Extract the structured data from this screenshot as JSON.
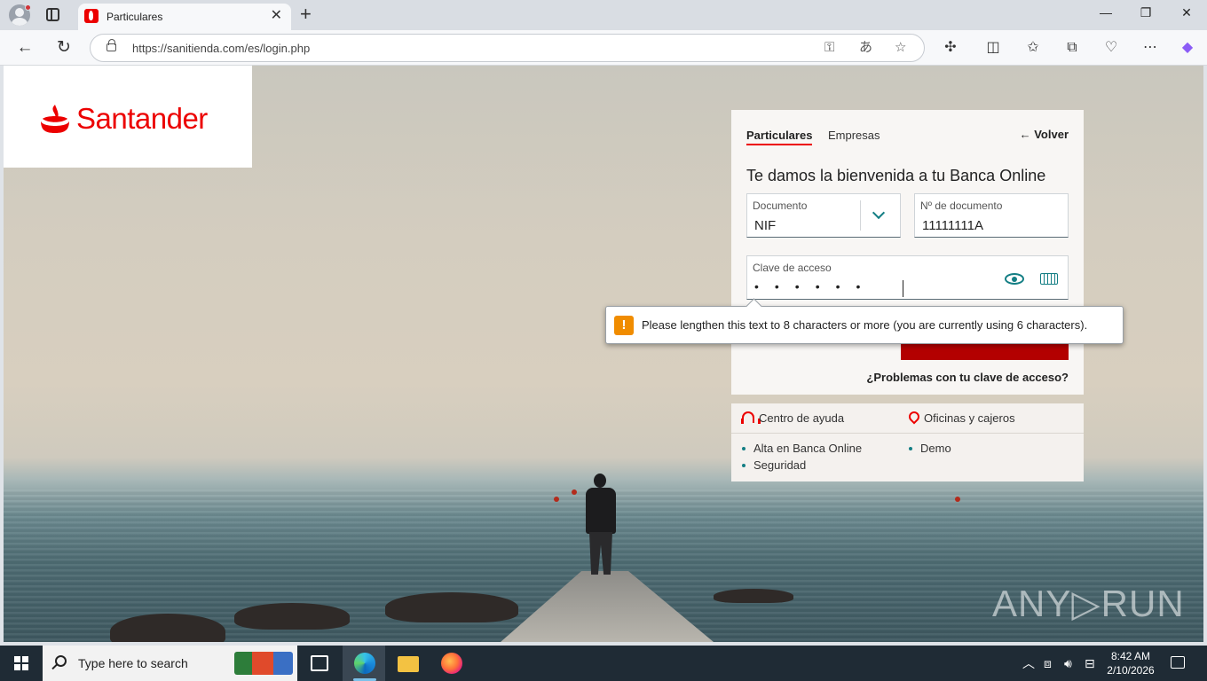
{
  "browser": {
    "tab_title": "Particulares",
    "url": "https://sanitienda.com/es/login.php",
    "tab_close_glyph": "✕",
    "new_tab_glyph": "+",
    "window_controls": [
      "—",
      "❐",
      "✕"
    ]
  },
  "page": {
    "brand": "Santander",
    "brand_color": "#ec0000",
    "tabs": [
      "Particulares",
      "Empresas"
    ],
    "back_label": "← Volver",
    "welcome": "Te damos la bienvenida a tu Banca Online",
    "document_type": {
      "label": "Documento",
      "value": "NIF"
    },
    "document_number": {
      "label": "Nº de documento",
      "value": "11111111A"
    },
    "password": {
      "label": "Clave de acceso",
      "masked_value": "••••••"
    },
    "problems_link": "¿Problemas con tu clave de acceso?",
    "help": {
      "help_center": "Centro de ayuda",
      "offices": "Oficinas y cajeros",
      "links_left": [
        "Alta en Banca Online",
        "Seguridad"
      ],
      "links_right": [
        "Demo"
      ]
    },
    "validation_tooltip": {
      "icon": "!",
      "text": "Please lengthen this text to 8 characters or more (you are currently using 6 characters)."
    },
    "watermark": "ANY▷RUN"
  },
  "taskbar": {
    "search_placeholder": "Type here to search",
    "time": "8:42 AM",
    "date": "2/10/2026"
  }
}
